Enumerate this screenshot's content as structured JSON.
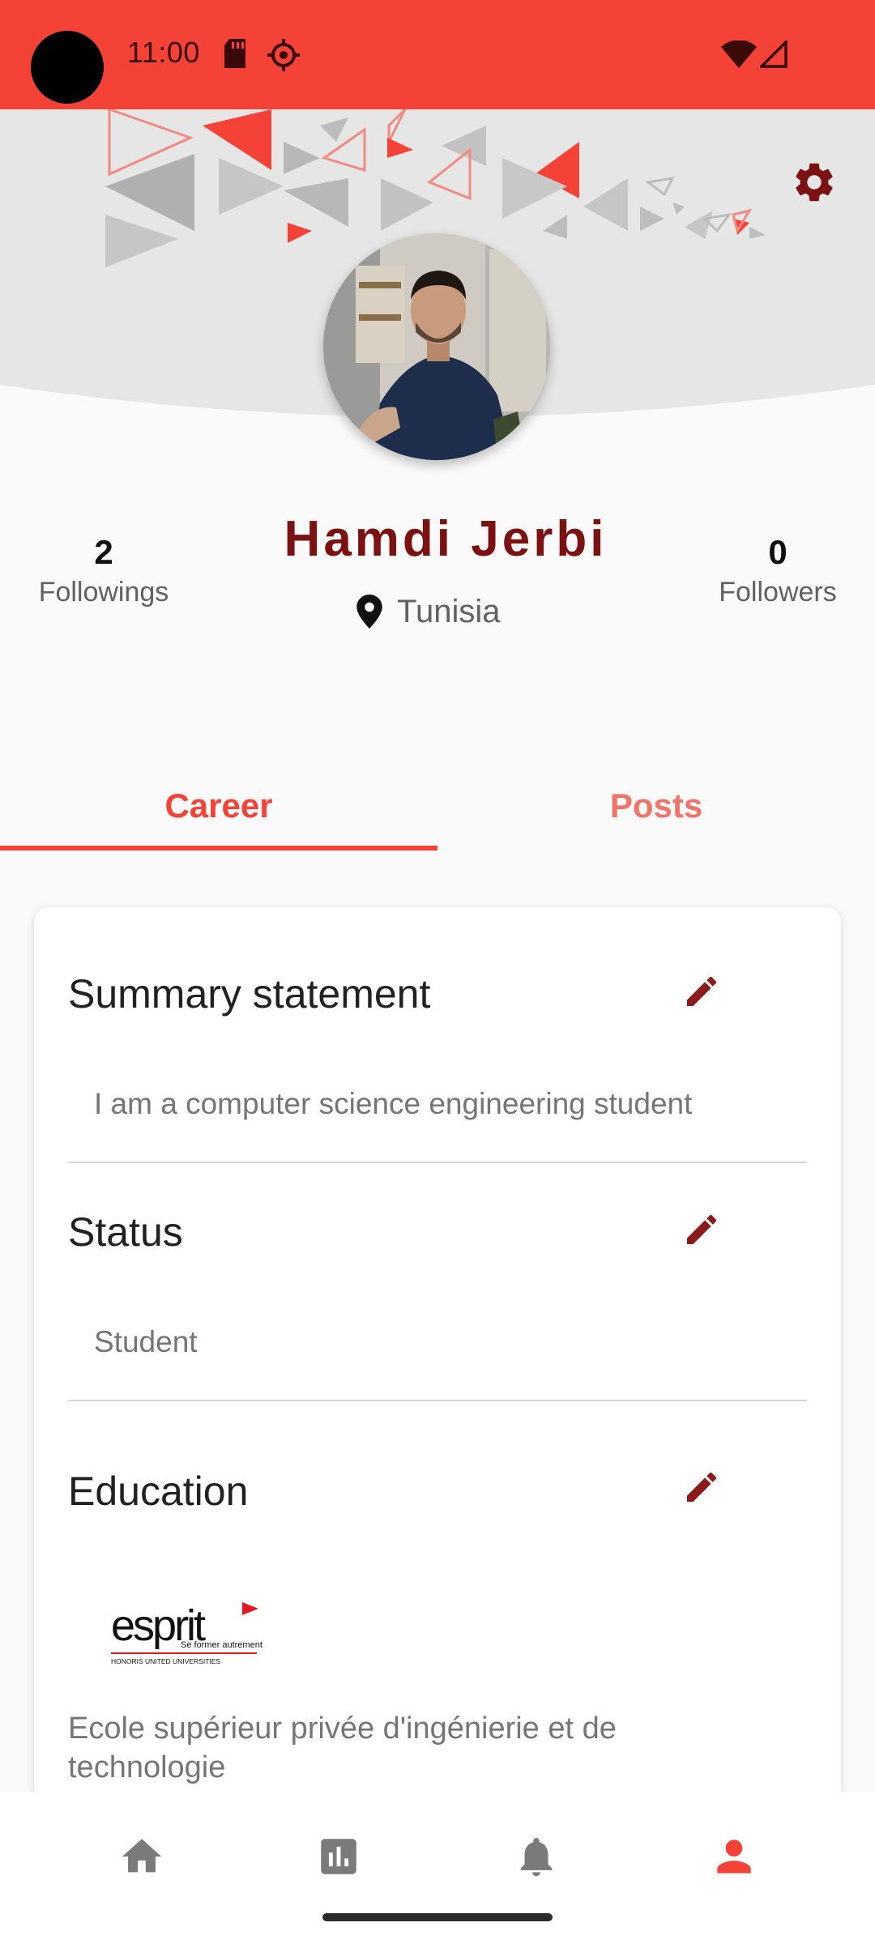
{
  "status_bar": {
    "time": "11:00",
    "icons": [
      "sd-card-icon",
      "debug-icon",
      "wifi-icon",
      "signal-icon"
    ],
    "background_color": "#f44336"
  },
  "header": {
    "settings_icon": "gear-icon",
    "accent_color": "#7b1111"
  },
  "profile": {
    "name": "Hamdi Jerbi",
    "location": "Tunisia",
    "location_icon": "location-pin-icon",
    "followings": {
      "count": "2",
      "label": "Followings"
    },
    "followers": {
      "count": "0",
      "label": "Followers"
    }
  },
  "tabs": [
    {
      "label": "Career",
      "selected": true
    },
    {
      "label": "Posts",
      "selected": false
    }
  ],
  "career": {
    "summary": {
      "title": "Summary statement",
      "text": "I am a computer science engineering student"
    },
    "status": {
      "title": "Status",
      "text": "Student"
    },
    "education": {
      "title": "Education",
      "logo": {
        "name": "esprit",
        "tagline": "Se former autrement",
        "footer": "HONORIS UNITED UNIVERSITIES"
      },
      "school": "Ecole supérieur privée d'ingénierie et de technologie"
    },
    "edit_icon": "pencil-icon"
  },
  "bottom_nav": {
    "items": [
      {
        "icon": "home-icon",
        "selected": false
      },
      {
        "icon": "chart-icon",
        "selected": false
      },
      {
        "icon": "bell-icon",
        "selected": false
      },
      {
        "icon": "person-icon",
        "selected": true
      }
    ],
    "active_color": "#f44336",
    "inactive_color": "#7a7a7a"
  }
}
